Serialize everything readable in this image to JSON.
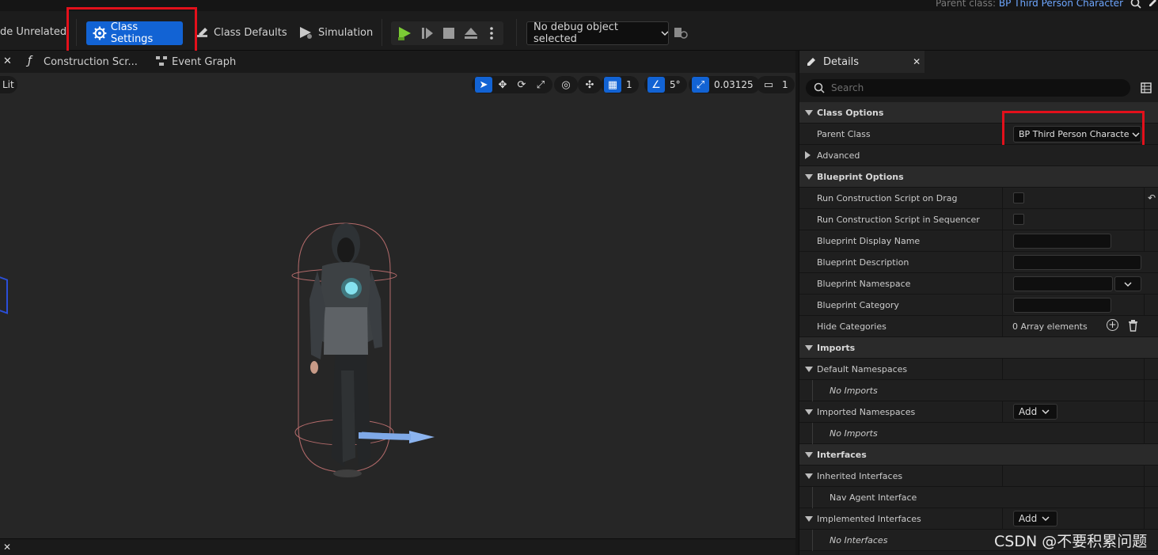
{
  "header": {
    "parent_class_label": "Parent class:",
    "parent_class_value": "BP Third Person Character"
  },
  "toolbar": {
    "hide_unrelated": "de Unrelated",
    "class_settings": "Class Settings",
    "class_defaults": "Class Defaults",
    "simulation": "Simulation",
    "debug_select": "No debug object selected"
  },
  "tabs": {
    "construction_script": "Construction Scr...",
    "event_graph": "Event Graph"
  },
  "viewport": {
    "view_mode": "Lit",
    "grid_size": "1",
    "rotation_snap": "5°",
    "scale_snap": "0.03125",
    "camera_speed": "1"
  },
  "details": {
    "tab_title": "Details",
    "search_placeholder": "Search",
    "categories": {
      "class_options": "Class Options",
      "blueprint_options": "Blueprint Options",
      "imports": "Imports",
      "interfaces": "Interfaces"
    },
    "parent_class_label": "Parent Class",
    "parent_class_value": "BP Third Person Characte",
    "advanced": "Advanced",
    "run_on_drag": "Run Construction Script on Drag",
    "run_in_sequencer": "Run Construction Script in Sequencer",
    "display_name": "Blueprint Display Name",
    "description": "Blueprint Description",
    "namespace": "Blueprint Namespace",
    "category": "Blueprint Category",
    "hide_categories": "Hide Categories",
    "array_elements": "0 Array elements",
    "default_namespaces": "Default Namespaces",
    "no_imports_1": "No Imports",
    "imported_namespaces": "Imported Namespaces",
    "add_1": "Add",
    "no_imports_2": "No Imports",
    "inherited_interfaces": "Inherited Interfaces",
    "nav_agent_interface": "Nav Agent Interface",
    "implemented_interfaces": "Implemented Interfaces",
    "add_2": "Add",
    "no_interfaces": "No Interfaces"
  },
  "watermark": "CSDN @不要积累问题",
  "colors": {
    "accent": "#1263d4",
    "highlight": "#e3101b",
    "link": "#6ea7ff"
  }
}
